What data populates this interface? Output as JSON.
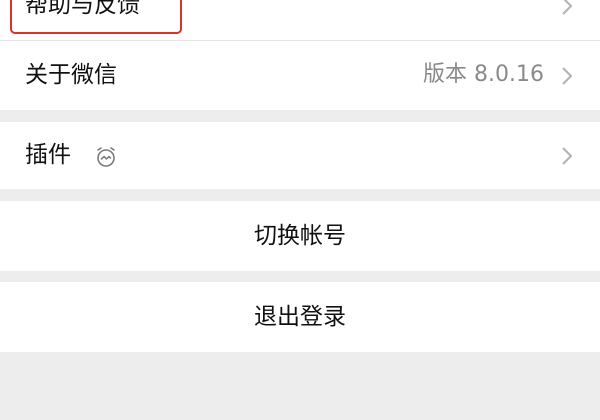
{
  "settings": {
    "help_feedback": {
      "label": "帮助与反馈"
    },
    "about": {
      "label": "关于微信",
      "version": "版本 8.0.16"
    },
    "plugin": {
      "label": "插件",
      "icon": "plugin-alarm-icon"
    },
    "switch_account": {
      "label": "切换帐号"
    },
    "logout": {
      "label": "退出登录"
    }
  },
  "colors": {
    "background": "#ededed",
    "row": "#ffffff",
    "highlight": "#d9322b",
    "secondary_text": "#8a8a8a",
    "chevron": "#b2b2b2"
  }
}
